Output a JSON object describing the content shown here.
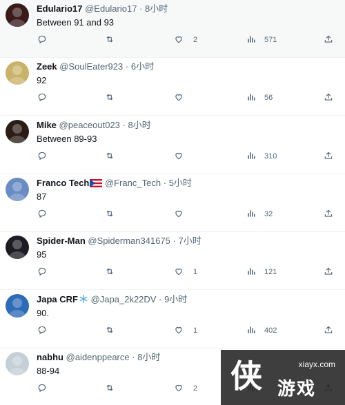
{
  "tweets": [
    {
      "name": "Edulario17",
      "handle": "@Edulario17",
      "dot": "·",
      "time": "8小时",
      "text": "Between 91 and 93",
      "replies": "",
      "retweets": "",
      "likes": "2",
      "views": "571",
      "avatar_color": "#3a1a1a",
      "highlighted": true
    },
    {
      "name": "Zeek",
      "handle": "@SoulEater923",
      "dot": "·",
      "time": "6小时",
      "text": "92",
      "replies": "",
      "retweets": "",
      "likes": "",
      "views": "56",
      "avatar_color": "#c9b36a",
      "highlighted": false
    },
    {
      "name": "Mike",
      "handle": "@peaceout023",
      "dot": "·",
      "time": "8小时",
      "text": "Between 89-93",
      "replies": "",
      "retweets": "",
      "likes": "",
      "views": "310",
      "avatar_color": "#2b1c16",
      "highlighted": false
    },
    {
      "name": "Franco Tech",
      "handle": "@Franc_Tech",
      "dot": "·",
      "time": "5小时",
      "text": "87",
      "replies": "",
      "retweets": "",
      "likes": "",
      "views": "32",
      "avatar_color": "#6a8cc4",
      "highlighted": false,
      "badge": "flag-icon"
    },
    {
      "name": "Spider-Man",
      "handle": "@Spiderman341675",
      "dot": "·",
      "time": "7小时",
      "text": "95",
      "replies": "",
      "retweets": "",
      "likes": "1",
      "views": "121",
      "avatar_color": "#1c1c22",
      "highlighted": false
    },
    {
      "name": "Japa CRF",
      "handle": "@Japa_2k22DV",
      "dot": "·",
      "time": "9小时",
      "text": "90.",
      "replies": "",
      "retweets": "",
      "likes": "1",
      "views": "402",
      "avatar_color": "#2e6bb8",
      "highlighted": false,
      "badge": "snowflake-icon"
    },
    {
      "name": "nabhu",
      "handle": "@aidenppearce",
      "dot": "·",
      "time": "8小时",
      "text": "88-94",
      "replies": "",
      "retweets": "",
      "likes": "2",
      "views": "",
      "avatar_color": "#c4cfd6",
      "highlighted": false
    }
  ],
  "watermark": {
    "domain": "xiayx.com",
    "logo": "侠",
    "sub": "游戏"
  },
  "colors": {
    "muted": "#536471",
    "text": "#0f1419",
    "divider": "#eff3f4",
    "highlight": "#f7f9f9"
  }
}
